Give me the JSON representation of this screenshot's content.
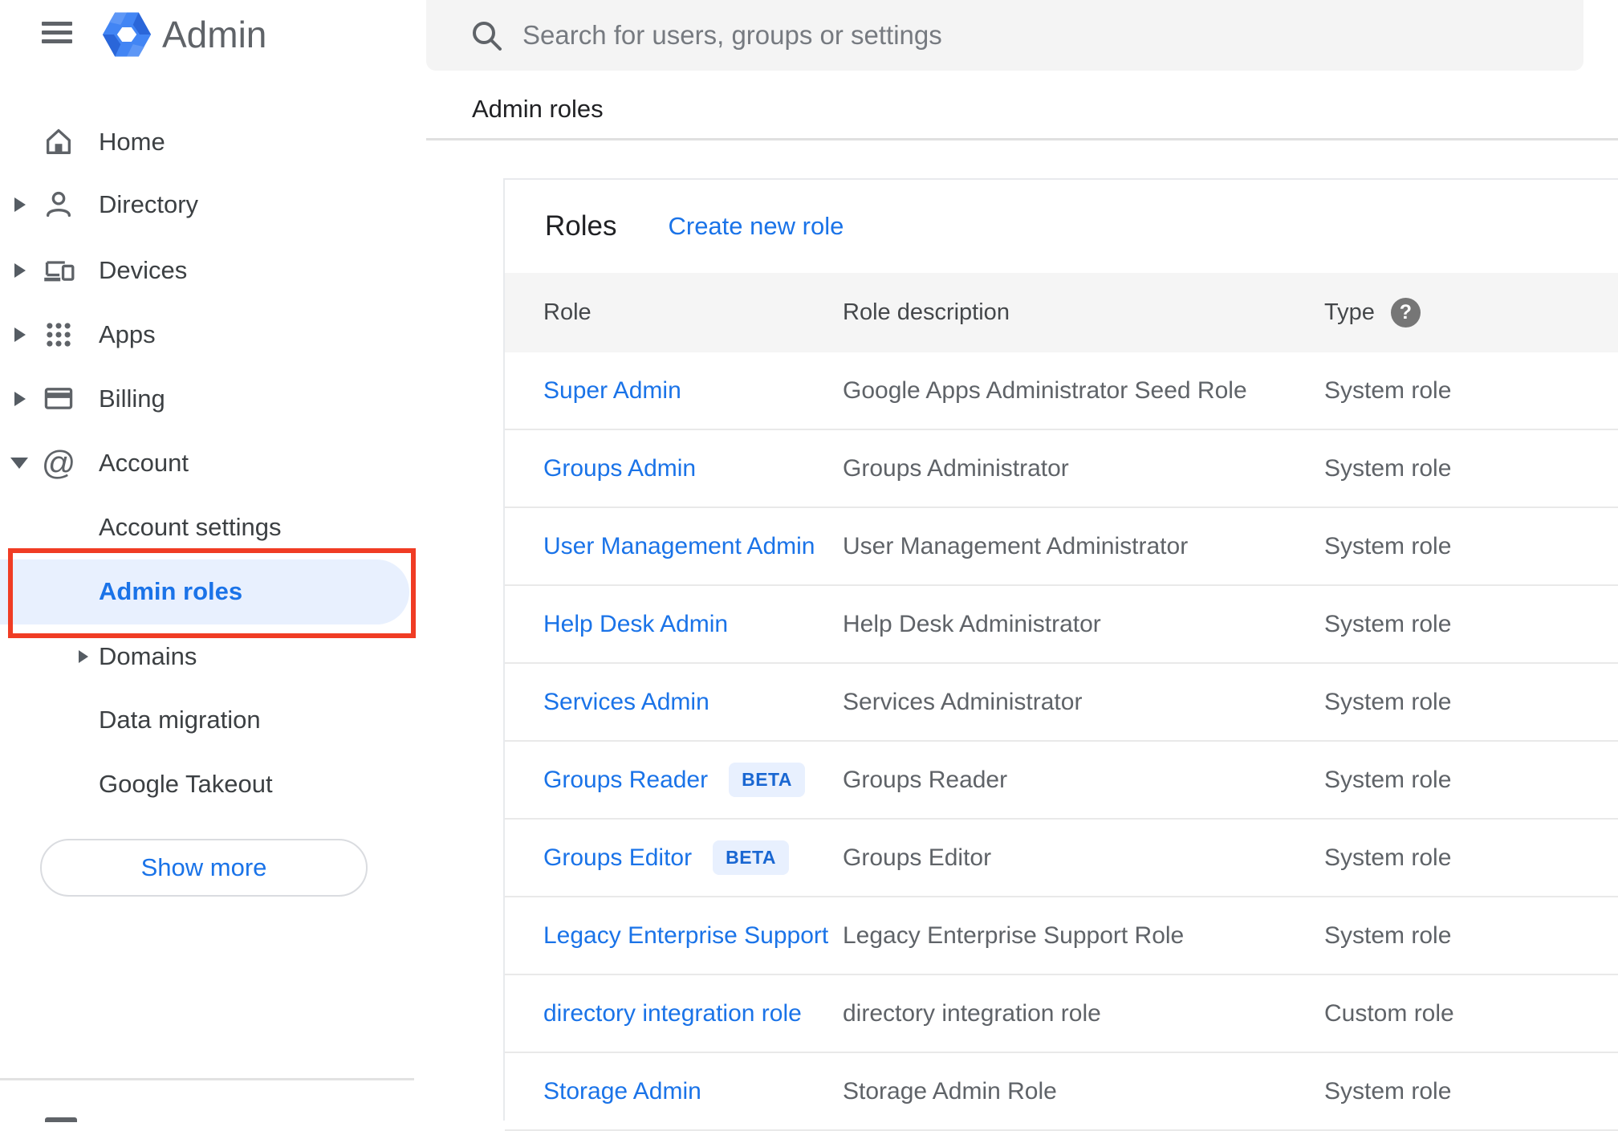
{
  "app": {
    "name": "Admin"
  },
  "search": {
    "placeholder": "Search for users, groups or settings"
  },
  "breadcrumb": "Admin roles",
  "sidebar": {
    "items": [
      {
        "label": "Home"
      },
      {
        "label": "Directory"
      },
      {
        "label": "Devices"
      },
      {
        "label": "Apps"
      },
      {
        "label": "Billing"
      },
      {
        "label": "Account"
      }
    ],
    "account_children": [
      {
        "label": "Account settings"
      },
      {
        "label": "Admin roles",
        "active": true
      },
      {
        "label": "Domains"
      },
      {
        "label": "Data migration"
      },
      {
        "label": "Google Takeout"
      }
    ],
    "show_more_label": "Show more"
  },
  "roles_card": {
    "title": "Roles",
    "create_link": "Create new role",
    "beta_label": "BETA",
    "columns": {
      "role": "Role",
      "description": "Role description",
      "type": "Type"
    },
    "rows": [
      {
        "role": "Super Admin",
        "beta": false,
        "description": "Google Apps Administrator Seed Role",
        "type": "System role"
      },
      {
        "role": "Groups Admin",
        "beta": false,
        "description": "Groups Administrator",
        "type": "System role"
      },
      {
        "role": "User Management Admin",
        "beta": false,
        "description": "User Management Administrator",
        "type": "System role"
      },
      {
        "role": "Help Desk Admin",
        "beta": false,
        "description": "Help Desk Administrator",
        "type": "System role"
      },
      {
        "role": "Services Admin",
        "beta": false,
        "description": "Services Administrator",
        "type": "System role"
      },
      {
        "role": "Groups Reader",
        "beta": true,
        "description": "Groups Reader",
        "type": "System role"
      },
      {
        "role": "Groups Editor",
        "beta": true,
        "description": "Groups Editor",
        "type": "System role"
      },
      {
        "role": "Legacy Enterprise Support",
        "beta": false,
        "description": "Legacy Enterprise Support Role",
        "type": "System role"
      },
      {
        "role": "directory integration role",
        "beta": false,
        "description": "directory integration role",
        "type": "Custom role"
      },
      {
        "role": "Storage Admin",
        "beta": false,
        "description": "Storage Admin Role",
        "type": "System role"
      }
    ]
  },
  "colors": {
    "accent_blue": "#1a73e8",
    "annotation_red": "#f03c24",
    "active_pill_bg": "#e8f0fe",
    "beta_badge_bg": "#e8f0fe",
    "beta_badge_text": "#1a67d2",
    "table_header_bg": "#f5f5f5",
    "icon_gray": "#5f6368"
  }
}
